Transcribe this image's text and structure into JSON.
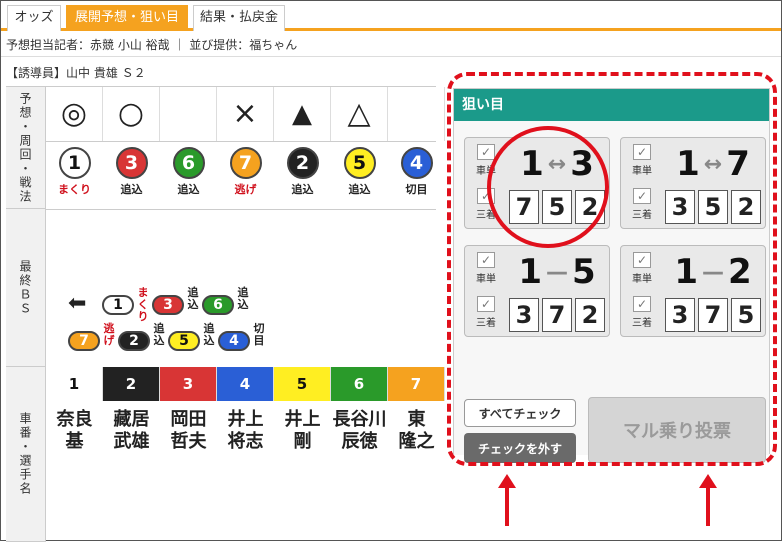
{
  "tabs": [
    "オッズ",
    "展開予想・狙い目",
    "結果・払戻金"
  ],
  "active_tab": 1,
  "reporter_line": "予想担当記者：赤競 小山 裕哉 ｜ 並び提供：福ちゃん",
  "guide_line": "【誘導員】山中 貴雄 Ｓ２",
  "row_labels": {
    "prediction": "予想・周回・戦法",
    "final_bs": "最終ＢＳ",
    "bib": "車番・選手名"
  },
  "marks": [
    "◎",
    "○",
    "",
    "×",
    "▲",
    "△",
    ""
  ],
  "riders": [
    {
      "num": "1",
      "tactic": "まくり",
      "tactic_color": "#d0101c",
      "fill": "#ffffff",
      "text": "#111111",
      "name": "奈良\n基",
      "head_bg": "#ffffff",
      "head_fg": "#111111"
    },
    {
      "num": "3",
      "tactic": "追込",
      "tactic_color": "#222222",
      "fill": "#d83535",
      "text": "#ffffff",
      "name": "藏居\n武雄",
      "head_bg": "#222222",
      "head_fg": "#ffffff"
    },
    {
      "num": "6",
      "tactic": "追込",
      "tactic_color": "#222222",
      "fill": "#2a9a2a",
      "text": "#ffffff",
      "name": "岡田\n哲夫",
      "head_bg": "#d83535",
      "head_fg": "#ffffff"
    },
    {
      "num": "7",
      "tactic": "逃げ",
      "tactic_color": "#d0101c",
      "fill": "#f5a21f",
      "text": "#ffffff",
      "name": "井上\n将志",
      "head_bg": "#2a5fd6",
      "head_fg": "#ffffff"
    },
    {
      "num": "2",
      "tactic": "追込",
      "tactic_color": "#222222",
      "fill": "#222222",
      "text": "#ffffff",
      "name": "井上\n剛",
      "head_bg": "#ffee22",
      "head_fg": "#111111"
    },
    {
      "num": "5",
      "tactic": "追込",
      "tactic_color": "#222222",
      "fill": "#ffee22",
      "text": "#111111",
      "name": "長谷川\n辰徳",
      "head_bg": "#2a9a2a",
      "head_fg": "#ffffff"
    },
    {
      "num": "4",
      "tactic": "切目",
      "tactic_color": "#222222",
      "fill": "#2a5fd6",
      "text": "#ffffff",
      "name": "東\n隆之",
      "head_bg": "#f5a21f",
      "head_fg": "#ffffff"
    }
  ],
  "bib_numbers": [
    "1",
    "2",
    "3",
    "4",
    "5",
    "6",
    "7"
  ],
  "final_bs": {
    "arrow": "⬅",
    "row1": [
      {
        "num": "1",
        "fill": "#ffffff",
        "text": "#111111",
        "label": "まくり",
        "label_color": "#d0101c"
      },
      {
        "num": "3",
        "fill": "#d83535",
        "text": "#ffffff",
        "label": "追込",
        "label_color": "#222222"
      },
      {
        "num": "6",
        "fill": "#2a9a2a",
        "text": "#ffffff",
        "label": "追込",
        "label_color": "#222222"
      }
    ],
    "row2": [
      {
        "num": "7",
        "fill": "#f5a21f",
        "text": "#ffffff",
        "label": "逃げ",
        "label_color": "#d0101c"
      },
      {
        "num": "2",
        "fill": "#222222",
        "text": "#ffffff",
        "label": "追込",
        "label_color": "#222222"
      },
      {
        "num": "5",
        "fill": "#ffee22",
        "text": "#111111",
        "label": "追込",
        "label_color": "#222222"
      },
      {
        "num": "4",
        "fill": "#2a5fd6",
        "text": "#ffffff",
        "label": "切目",
        "label_color": "#222222"
      }
    ]
  },
  "target": {
    "header": "狙い目",
    "cards": [
      {
        "a": "1",
        "sym": "↔",
        "b": "3",
        "boxes": [
          "7",
          "5",
          "2"
        ],
        "chk1": "車単",
        "chk2": "三着"
      },
      {
        "a": "1",
        "sym": "↔",
        "b": "7",
        "boxes": [
          "3",
          "5",
          "2"
        ],
        "chk1": "車単",
        "chk2": "三着"
      },
      {
        "a": "1",
        "sym": "—",
        "b": "5",
        "boxes": [
          "3",
          "7",
          "2"
        ],
        "chk1": "車単",
        "chk2": "三着"
      },
      {
        "a": "1",
        "sym": "—",
        "b": "2",
        "boxes": [
          "3",
          "7",
          "5"
        ],
        "chk1": "車単",
        "chk2": "三着"
      }
    ],
    "check_all": "すべてチェック",
    "uncheck": "チェックを外す",
    "bet_button": "マル乗り投票"
  },
  "colors": {
    "accent": "#f5a21f",
    "panel_head": "#1b9a8a",
    "highlight": "#e0101c"
  }
}
